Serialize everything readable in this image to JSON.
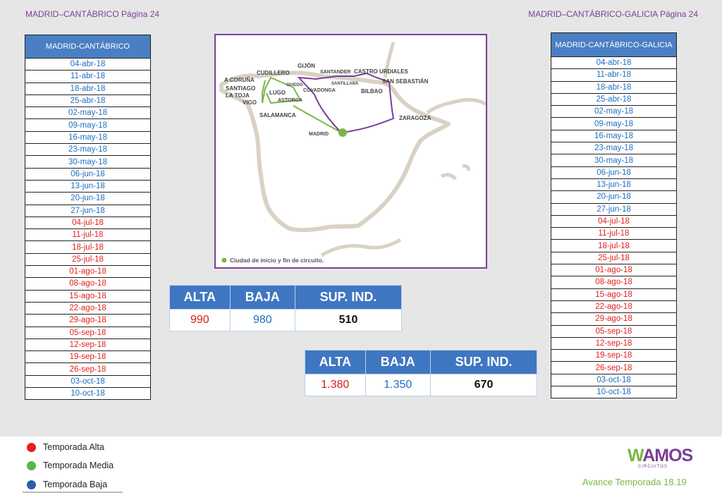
{
  "header": {
    "left_title": "MADRID–CANTÁBRICO Página 24",
    "right_title": "MADRID–CANTÁBRICO-GALICIA Página 24"
  },
  "colors": {
    "alta": "#e02020",
    "media": "#27a04a",
    "baja": "#1f6fc0",
    "route_purple": "#7a3f98",
    "route_green": "#7ab648"
  },
  "left_table": {
    "header": "MADRID-CANTÁBRICO",
    "rows": [
      {
        "date": "04-abr-18",
        "season": "baja"
      },
      {
        "date": "11-abr-18",
        "season": "baja"
      },
      {
        "date": "18-abr-18",
        "season": "baja"
      },
      {
        "date": "25-abr-18",
        "season": "baja"
      },
      {
        "date": "02-may-18",
        "season": "baja"
      },
      {
        "date": "09-may-18",
        "season": "baja"
      },
      {
        "date": "16-may-18",
        "season": "baja"
      },
      {
        "date": "23-may-18",
        "season": "baja"
      },
      {
        "date": "30-may-18",
        "season": "baja"
      },
      {
        "date": "06-jun-18",
        "season": "baja"
      },
      {
        "date": "13-jun-18",
        "season": "baja"
      },
      {
        "date": "20-jun-18",
        "season": "baja"
      },
      {
        "date": "27-jun-18",
        "season": "baja"
      },
      {
        "date": "04-jul-18",
        "season": "alta"
      },
      {
        "date": "11-jul-18",
        "season": "alta"
      },
      {
        "date": "18-jul-18",
        "season": "alta"
      },
      {
        "date": "25-jul-18",
        "season": "alta"
      },
      {
        "date": "01-ago-18",
        "season": "alta"
      },
      {
        "date": "08-ago-18",
        "season": "alta"
      },
      {
        "date": "15-ago-18",
        "season": "alta"
      },
      {
        "date": "22-ago-18",
        "season": "alta"
      },
      {
        "date": "29-ago-18",
        "season": "alta"
      },
      {
        "date": "05-sep-18",
        "season": "alta"
      },
      {
        "date": "12-sep-18",
        "season": "alta"
      },
      {
        "date": "19-sep-18",
        "season": "alta"
      },
      {
        "date": "26-sep-18",
        "season": "alta"
      },
      {
        "date": "03-oct-18",
        "season": "baja"
      },
      {
        "date": "10-oct-18",
        "season": "baja"
      }
    ]
  },
  "right_table": {
    "header": "MADRID-CANTÁBRICO-GALICIA",
    "rows": [
      {
        "date": "04-abr-18",
        "season": "baja"
      },
      {
        "date": "11-abr-18",
        "season": "baja"
      },
      {
        "date": "18-abr-18",
        "season": "baja"
      },
      {
        "date": "25-abr-18",
        "season": "baja"
      },
      {
        "date": "02-may-18",
        "season": "baja"
      },
      {
        "date": "09-may-18",
        "season": "baja"
      },
      {
        "date": "16-may-18",
        "season": "baja"
      },
      {
        "date": "23-may-18",
        "season": "baja"
      },
      {
        "date": "30-may-18",
        "season": "baja"
      },
      {
        "date": "06-jun-18",
        "season": "baja"
      },
      {
        "date": "13-jun-18",
        "season": "baja"
      },
      {
        "date": "20-jun-18",
        "season": "baja"
      },
      {
        "date": "27-jun-18",
        "season": "baja"
      },
      {
        "date": "04-jul-18",
        "season": "alta"
      },
      {
        "date": "11-jul-18",
        "season": "alta"
      },
      {
        "date": "18-jul-18",
        "season": "alta"
      },
      {
        "date": "25-jul-18",
        "season": "alta"
      },
      {
        "date": "01-ago-18",
        "season": "alta"
      },
      {
        "date": "08-ago-18",
        "season": "alta"
      },
      {
        "date": "15-ago-18",
        "season": "alta"
      },
      {
        "date": "22-ago-18",
        "season": "alta"
      },
      {
        "date": "29-ago-18",
        "season": "alta"
      },
      {
        "date": "05-sep-18",
        "season": "alta"
      },
      {
        "date": "12-sep-18",
        "season": "alta"
      },
      {
        "date": "19-sep-18",
        "season": "alta"
      },
      {
        "date": "26-sep-18",
        "season": "alta"
      },
      {
        "date": "03-oct-18",
        "season": "baja"
      },
      {
        "date": "10-oct-18",
        "season": "baja"
      }
    ]
  },
  "map": {
    "cities": [
      "A CORUÑA",
      "SANTIAGO",
      "LA TOJA",
      "VIGO",
      "CUDILLERO",
      "GIJÓN",
      "OVIEDO",
      "LUGO",
      "ASTORGA",
      "COVADONGA",
      "SANTANDER",
      "SANTILLANA",
      "CASTRO URDIALES",
      "BILBAO",
      "SAN SEBASTIÁN",
      "ZARAGOZA",
      "SALAMANCA",
      "MADRID"
    ],
    "legend": "Ciudad de inicio y fin de circuito."
  },
  "prices_1": {
    "headers": [
      "ALTA",
      "BAJA",
      "SUP. IND."
    ],
    "values": [
      "990",
      "980",
      "510"
    ]
  },
  "prices_2": {
    "headers": [
      "ALTA",
      "BAJA",
      "SUP. IND."
    ],
    "values": [
      "1.380",
      "1.350",
      "670"
    ]
  },
  "legend": [
    {
      "label": "Temporada Alta",
      "color": "#e61e1e"
    },
    {
      "label": "Temporada Media",
      "color": "#5ab54a"
    },
    {
      "label": "Temporada Baja",
      "color": "#2a5fa8"
    }
  ],
  "footer": {
    "logo_w": "W",
    "logo_rest": "AMOS",
    "logo_sub": "CIRCUITOS",
    "avance": "Avance Temporada 18.19"
  }
}
